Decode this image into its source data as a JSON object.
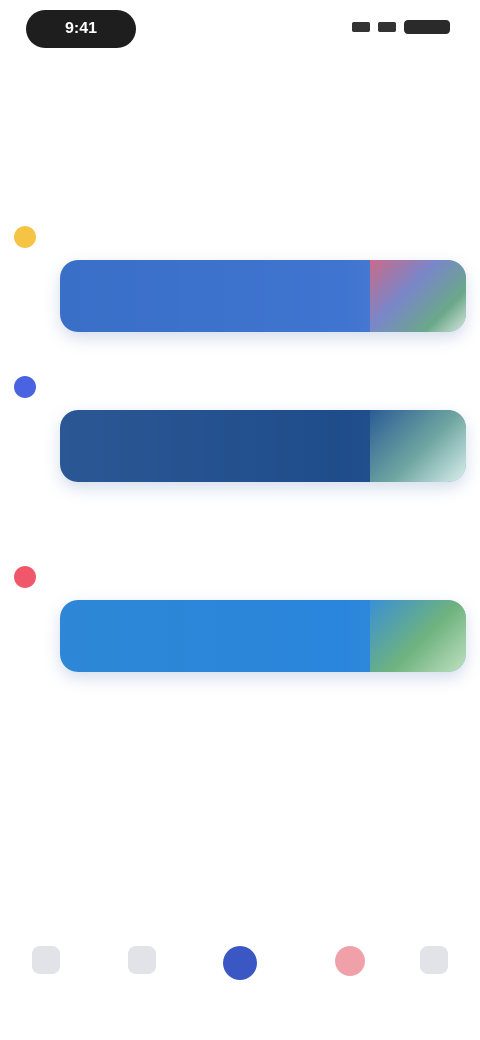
{
  "status": {
    "time": "9:41",
    "icons": [
      "signal-icon",
      "wifi-icon",
      "battery-icon"
    ]
  },
  "header": {
    "title": ""
  },
  "sections": [
    {
      "title": ""
    },
    {
      "title": ""
    }
  ],
  "groups": [
    {
      "label": "",
      "dot_color": "#f6c445",
      "label_color": "#f6a21a",
      "card": {
        "line1": "",
        "line2": "",
        "color": "#3a6fc8",
        "thumb_color": "#6aa889"
      }
    },
    {
      "label": "",
      "dot_color": "#4a63e0",
      "label_color": "#4a63e0",
      "card": {
        "line1": "",
        "line2": "",
        "color": "#24528f",
        "thumb_color": "#6fa6a1"
      }
    },
    {
      "label": "",
      "dot_color": "#f0576a",
      "label_color": "#e24b63",
      "card": {
        "line1": "",
        "line2": "",
        "color": "#2d87d6",
        "thumb_color": "#6fb37d"
      }
    }
  ],
  "footer": {
    "note": "",
    "link": ""
  },
  "tabbar": {
    "tabs": [
      {
        "label": "",
        "icon": "home-icon"
      },
      {
        "label": "",
        "icon": "list-icon"
      },
      {
        "label": "",
        "icon": "center-action-icon"
      },
      {
        "label": "",
        "icon": "heart-icon"
      },
      {
        "label": "",
        "icon": "profile-icon"
      }
    ]
  }
}
